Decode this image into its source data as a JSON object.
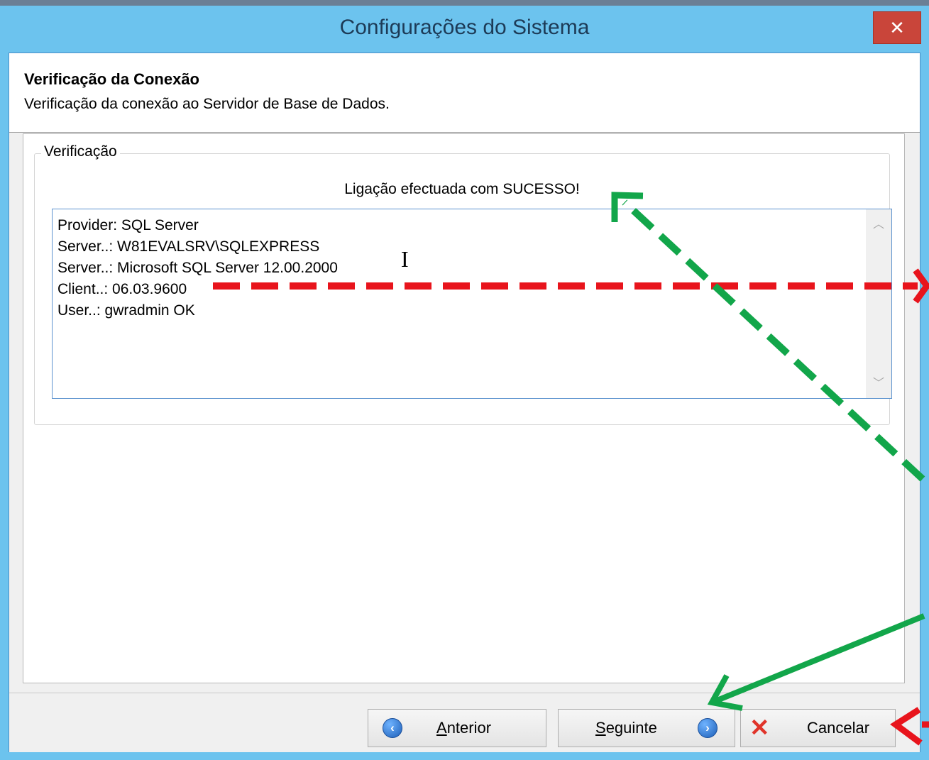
{
  "window": {
    "title": "Configurações do Sistema",
    "close_glyph": "✕"
  },
  "header": {
    "title": "Verificação da Conexão",
    "subtitle": "Verificação da conexão ao Servidor de Base de Dados."
  },
  "group": {
    "legend": "Verificação",
    "status": "Ligação efectuada com SUCESSO!",
    "log_lines": [
      "Provider: SQL Server",
      "Server..: W81EVALSRV\\SQLEXPRESS",
      "Server..: Microsoft SQL Server 12.00.2000",
      "Client..: 06.03.9600",
      "User..: gwradmin OK"
    ]
  },
  "buttons": {
    "previous": {
      "label": "Anterior",
      "icon": "arrow-left-circle-icon"
    },
    "next": {
      "label": "Seguinte",
      "icon": "arrow-right-circle-icon"
    },
    "cancel": {
      "label": "Cancelar",
      "icon": "red-x-icon"
    }
  },
  "colors": {
    "titlebar": "#6cc3ee",
    "close_button": "#c9453a",
    "annotation_red": "#e8141c",
    "annotation_green": "#12a64a"
  }
}
